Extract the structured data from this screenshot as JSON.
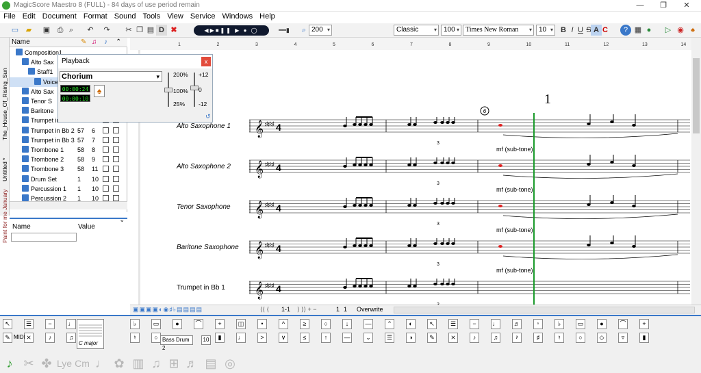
{
  "window": {
    "title": "MagicScore Maestro 8 (FULL) - 84 days of use period remain",
    "minimize": "—",
    "maximize": "❐",
    "close": "✕"
  },
  "menu": [
    "File",
    "Edit",
    "Document",
    "Format",
    "Sound",
    "Tools",
    "View",
    "Service",
    "Windows",
    "Help"
  ],
  "toolbar": {
    "zoom": "200",
    "style": "Classic",
    "style_size": "100",
    "font": "Times New Roman",
    "font_size": "10",
    "bold": "B",
    "italic": "I",
    "underline": "U",
    "strike": "S"
  },
  "vtabs": [
    "The_House_Of_Rising_Sun",
    "Untitled *",
    "Paint for me January"
  ],
  "tree": {
    "header": "Name",
    "rows": [
      {
        "label": "Composition1",
        "a": "",
        "b": "",
        "indent": 1
      },
      {
        "label": "Alto Sax",
        "a": "",
        "b": "",
        "indent": 2
      },
      {
        "label": "Staff1",
        "a": "",
        "b": "",
        "indent": 3
      },
      {
        "label": "Voice1",
        "a": "",
        "b": "",
        "indent": 4
      },
      {
        "label": "Alto Sax",
        "a": "",
        "b": "",
        "indent": 2
      },
      {
        "label": "Tenor S",
        "a": "",
        "b": "",
        "indent": 2
      },
      {
        "label": "Baritone",
        "a": "",
        "b": "",
        "indent": 2
      },
      {
        "label": "Trumpet in Bb 1",
        "a": "57",
        "b": "5",
        "indent": 2
      },
      {
        "label": "Trumpet in Bb 2",
        "a": "57",
        "b": "6",
        "indent": 2
      },
      {
        "label": "Trumpet in Bb 3",
        "a": "57",
        "b": "7",
        "indent": 2
      },
      {
        "label": "Trombone 1",
        "a": "58",
        "b": "8",
        "indent": 2
      },
      {
        "label": "Trombone 2",
        "a": "58",
        "b": "9",
        "indent": 2
      },
      {
        "label": "Trombone 3",
        "a": "58",
        "b": "11",
        "indent": 2
      },
      {
        "label": "Drum Set",
        "a": "1",
        "b": "10",
        "indent": 2
      },
      {
        "label": "Percussion 1",
        "a": "1",
        "b": "10",
        "indent": 2
      },
      {
        "label": "Percussion 2",
        "a": "1",
        "b": "10",
        "indent": 2
      }
    ]
  },
  "props": {
    "name": "Name",
    "value": "Value"
  },
  "playback": {
    "title": "Playback",
    "close": "x",
    "instrument": "Chorium",
    "time1": "00:00:24",
    "time2": "00:00:10",
    "tempo_max": "200%",
    "tempo_mid": "100%",
    "tempo_min": "25%",
    "pitch_max": "+12",
    "pitch_mid": "0",
    "pitch_min": "-12"
  },
  "score": {
    "page_number": "1",
    "rehearsal": "6",
    "staves": [
      "Alto Saxophone 1",
      "Alto Saxophone 2",
      "Tenor Saxophone",
      "Baritone Saxophone",
      "Trumpet in Bb 1"
    ],
    "dynamics": [
      "mf (sub-tone)",
      "mf (sub-tone)",
      "mf (sub-tone)",
      "mf (sub-tone)"
    ],
    "ruler": [
      "1",
      "2",
      "3",
      "4",
      "5",
      "6",
      "7",
      "8",
      "9",
      "10",
      "11",
      "12",
      "13",
      "14"
    ],
    "tuplet": "3"
  },
  "statusbar": {
    "pos": "1-1",
    "bar": "1",
    "beat": "1",
    "mode": "Overwrite"
  },
  "palette": {
    "key": "C major",
    "instrument": "Bass Drum 2",
    "midi": "MIDI",
    "time_sig": "10"
  }
}
